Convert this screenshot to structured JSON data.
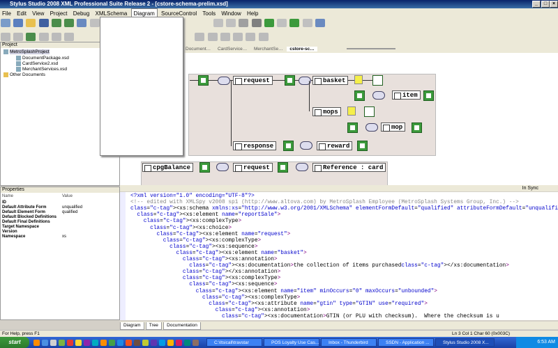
{
  "window": {
    "title": "Stylus Studio 2008 XML Professional Suite Release 2 - [cstore-schema-prelim.xsd]"
  },
  "menu": {
    "items": [
      "File",
      "Edit",
      "View",
      "Project",
      "Debug",
      "XMLSchema",
      "Diagram",
      "SourceControl",
      "Tools",
      "Window",
      "Help"
    ]
  },
  "doc_tabs": [
    "Document…",
    "CardService…",
    "MerchantSe…",
    "cstore-sc…"
  ],
  "project": {
    "title": "Project",
    "root": "MetroSplashProject",
    "files": [
      "DocumentPackage.xsd",
      "CardService2.xsd",
      "MerchantServices.xsd"
    ],
    "other": "Other Documents"
  },
  "properties": {
    "title": "Properties",
    "col_name": "Name",
    "col_value": "Value",
    "rows": [
      {
        "name": "ID",
        "value": ""
      },
      {
        "name": "Default Attribute Form",
        "value": "unqualified"
      },
      {
        "name": "Default Element Form",
        "value": "qualified"
      },
      {
        "name": "Default Blocked Definitions",
        "value": ""
      },
      {
        "name": "Default Final Definitions",
        "value": ""
      },
      {
        "name": "Target Namespace",
        "value": ""
      },
      {
        "name": "Version",
        "value": ""
      },
      {
        "name": "Namespace",
        "value": "xs"
      }
    ]
  },
  "diagram": {
    "nodes": {
      "request": "request",
      "basket": "basket",
      "item": "item",
      "mops": "mops",
      "mop": "mop",
      "response": "response",
      "reward": "reward",
      "cpgBalance": "cpgBalance",
      "request2": "request",
      "reference": "Reference : card"
    }
  },
  "code": {
    "sync": "In Sync",
    "lines": [
      "<?xml version=\"1.0\" encoding=\"UTF-8\"?>",
      "<!-- edited with XMLSpy v2008 sp1 (http://www.altova.com) by MetroSplash Employee (MetroSplash Systems Group, Inc.) -->",
      "<xs:schema xmlns:xs=\"http://www.w3.org/2001/XMLSchema\" elementFormDefault=\"qualified\" attributeFormDefault=\"unqualified\">",
      "<xs:element name=\"reportSale\">",
      "<xs:complexType>",
      "<xs:choice>",
      "<xs:element name=\"request\">",
      "<xs:complexType>",
      "<xs:sequence>",
      "<xs:element name=\"basket\">",
      "<xs:annotation>",
      "<xs:documentation>the collection of items purchased</xs:documentation>",
      "</xs:annotation>",
      "<xs:complexType>",
      "<xs:sequence>",
      "<xs:element name=\"item\" minOccurs=\"0\" maxOccurs=\"unbounded\">",
      "<xs:complexType>",
      "<xs:attribute name=\"gtin\" type=\"GTIN\" use=\"required\">",
      "<xs:annotation>",
      "<xs:documentation>GTIN (or PLU with checksum).  Where the checksum is u"
    ],
    "indents": [
      0,
      0,
      0,
      2,
      4,
      6,
      8,
      10,
      12,
      14,
      16,
      18,
      16,
      16,
      18,
      20,
      22,
      24,
      26,
      28
    ]
  },
  "bottom_tabs": [
    "Diagram",
    "Tree",
    "Documentation"
  ],
  "status": {
    "left": "For Help, press F1",
    "right": "Ln 3 Col 1   Char 60 (0x003C)"
  },
  "taskbar": {
    "start": "start",
    "tasks": [
      "C:\\Itsicall\\travstar",
      "POS Loyalty Use Cas...",
      "Inbox - Thunderbird",
      "SSDN - Application ...",
      "Stylus Studio 2008 X..."
    ],
    "clock": "6:53 AM"
  }
}
